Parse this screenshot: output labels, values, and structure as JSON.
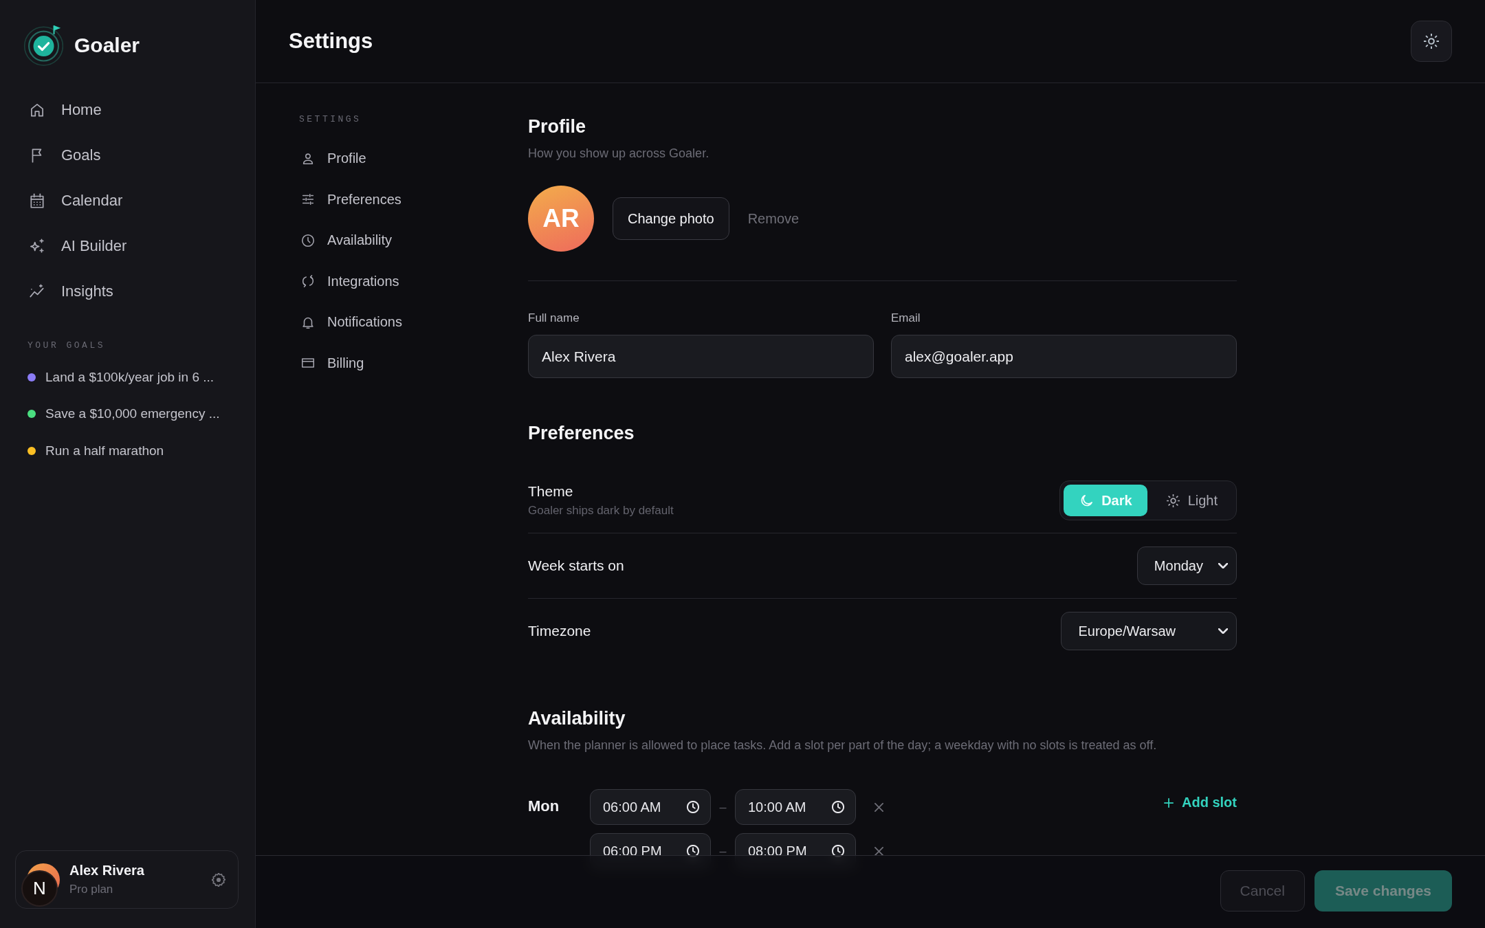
{
  "sidebar": {
    "brand": "Goaler",
    "nav": [
      {
        "label": "Home"
      },
      {
        "label": "Goals"
      },
      {
        "label": "Calendar"
      },
      {
        "label": "AI Builder"
      },
      {
        "label": "Insights"
      }
    ],
    "goals_label": "YOUR GOALS",
    "goals": [
      {
        "label": "Land a $100k/year job in 6 ...",
        "color": "#8b7cf6"
      },
      {
        "label": "Save a $10,000 emergency ...",
        "color": "#4ade80"
      },
      {
        "label": "Run a half marathon",
        "color": "#fbbf24"
      }
    ],
    "user": {
      "name": "Alex Rivera",
      "plan": "Pro plan"
    },
    "dev_badge": {
      "label": "N"
    }
  },
  "header": {
    "title": "Settings"
  },
  "settings_nav": {
    "label": "SETTINGS",
    "items": [
      {
        "label": "Profile"
      },
      {
        "label": "Preferences"
      },
      {
        "label": "Availability"
      },
      {
        "label": "Integrations"
      },
      {
        "label": "Notifications"
      },
      {
        "label": "Billing"
      }
    ]
  },
  "profile": {
    "title": "Profile",
    "subtitle": "How you show up across Goaler.",
    "avatar_initials": "AR",
    "change_photo": "Change photo",
    "remove": "Remove",
    "fields": [
      {
        "label": "Full name",
        "value": "Alex Rivera"
      },
      {
        "label": "Email",
        "value": "alex@goaler.app"
      }
    ]
  },
  "preferences": {
    "title": "Preferences",
    "theme": {
      "label": "Theme",
      "hint": "Goaler ships dark by default",
      "options": [
        {
          "label": "Dark",
          "selected": true
        },
        {
          "label": "Light",
          "selected": false
        }
      ]
    },
    "selects": [
      {
        "label": "Week starts on",
        "value": "Monday"
      },
      {
        "label": "Timezone",
        "value": "Europe/Warsaw"
      }
    ]
  },
  "availability": {
    "title": "Availability",
    "subtitle": "When the planner is allowed to place tasks. Add a slot per part of the day; a weekday with no slots is treated as off.",
    "days": [
      {
        "day": "Mon",
        "slots": [
          {
            "start": "06:00 AM",
            "sep": "–",
            "end": "10:00 AM"
          },
          {
            "start": "06:00 PM",
            "sep": "–",
            "end": "08:00 PM"
          }
        ],
        "add_label": "Add slot"
      }
    ]
  },
  "footer": {
    "buttons": [
      {
        "label": "Cancel",
        "kind": "secondary",
        "disabled": true
      },
      {
        "label": "Save changes",
        "kind": "primary",
        "disabled": true
      }
    ]
  }
}
